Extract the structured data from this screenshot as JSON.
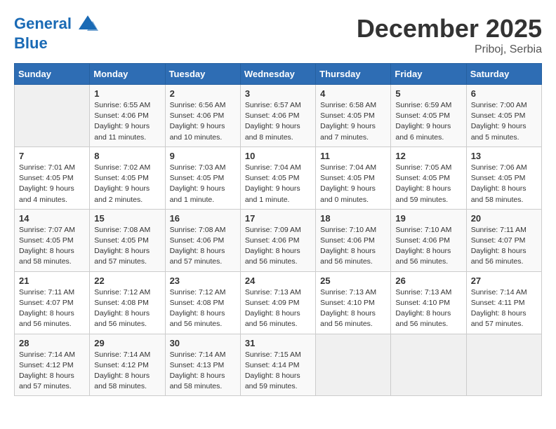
{
  "header": {
    "logo_line1": "General",
    "logo_line2": "Blue",
    "month": "December 2025",
    "location": "Priboj, Serbia"
  },
  "weekdays": [
    "Sunday",
    "Monday",
    "Tuesday",
    "Wednesday",
    "Thursday",
    "Friday",
    "Saturday"
  ],
  "weeks": [
    [
      {
        "day": "",
        "info": ""
      },
      {
        "day": "1",
        "info": "Sunrise: 6:55 AM\nSunset: 4:06 PM\nDaylight: 9 hours\nand 11 minutes."
      },
      {
        "day": "2",
        "info": "Sunrise: 6:56 AM\nSunset: 4:06 PM\nDaylight: 9 hours\nand 10 minutes."
      },
      {
        "day": "3",
        "info": "Sunrise: 6:57 AM\nSunset: 4:06 PM\nDaylight: 9 hours\nand 8 minutes."
      },
      {
        "day": "4",
        "info": "Sunrise: 6:58 AM\nSunset: 4:05 PM\nDaylight: 9 hours\nand 7 minutes."
      },
      {
        "day": "5",
        "info": "Sunrise: 6:59 AM\nSunset: 4:05 PM\nDaylight: 9 hours\nand 6 minutes."
      },
      {
        "day": "6",
        "info": "Sunrise: 7:00 AM\nSunset: 4:05 PM\nDaylight: 9 hours\nand 5 minutes."
      }
    ],
    [
      {
        "day": "7",
        "info": "Sunrise: 7:01 AM\nSunset: 4:05 PM\nDaylight: 9 hours\nand 4 minutes."
      },
      {
        "day": "8",
        "info": "Sunrise: 7:02 AM\nSunset: 4:05 PM\nDaylight: 9 hours\nand 2 minutes."
      },
      {
        "day": "9",
        "info": "Sunrise: 7:03 AM\nSunset: 4:05 PM\nDaylight: 9 hours\nand 1 minute."
      },
      {
        "day": "10",
        "info": "Sunrise: 7:04 AM\nSunset: 4:05 PM\nDaylight: 9 hours\nand 1 minute."
      },
      {
        "day": "11",
        "info": "Sunrise: 7:04 AM\nSunset: 4:05 PM\nDaylight: 9 hours\nand 0 minutes."
      },
      {
        "day": "12",
        "info": "Sunrise: 7:05 AM\nSunset: 4:05 PM\nDaylight: 8 hours\nand 59 minutes."
      },
      {
        "day": "13",
        "info": "Sunrise: 7:06 AM\nSunset: 4:05 PM\nDaylight: 8 hours\nand 58 minutes."
      }
    ],
    [
      {
        "day": "14",
        "info": "Sunrise: 7:07 AM\nSunset: 4:05 PM\nDaylight: 8 hours\nand 58 minutes."
      },
      {
        "day": "15",
        "info": "Sunrise: 7:08 AM\nSunset: 4:05 PM\nDaylight: 8 hours\nand 57 minutes."
      },
      {
        "day": "16",
        "info": "Sunrise: 7:08 AM\nSunset: 4:06 PM\nDaylight: 8 hours\nand 57 minutes."
      },
      {
        "day": "17",
        "info": "Sunrise: 7:09 AM\nSunset: 4:06 PM\nDaylight: 8 hours\nand 56 minutes."
      },
      {
        "day": "18",
        "info": "Sunrise: 7:10 AM\nSunset: 4:06 PM\nDaylight: 8 hours\nand 56 minutes."
      },
      {
        "day": "19",
        "info": "Sunrise: 7:10 AM\nSunset: 4:06 PM\nDaylight: 8 hours\nand 56 minutes."
      },
      {
        "day": "20",
        "info": "Sunrise: 7:11 AM\nSunset: 4:07 PM\nDaylight: 8 hours\nand 56 minutes."
      }
    ],
    [
      {
        "day": "21",
        "info": "Sunrise: 7:11 AM\nSunset: 4:07 PM\nDaylight: 8 hours\nand 56 minutes."
      },
      {
        "day": "22",
        "info": "Sunrise: 7:12 AM\nSunset: 4:08 PM\nDaylight: 8 hours\nand 56 minutes."
      },
      {
        "day": "23",
        "info": "Sunrise: 7:12 AM\nSunset: 4:08 PM\nDaylight: 8 hours\nand 56 minutes."
      },
      {
        "day": "24",
        "info": "Sunrise: 7:13 AM\nSunset: 4:09 PM\nDaylight: 8 hours\nand 56 minutes."
      },
      {
        "day": "25",
        "info": "Sunrise: 7:13 AM\nSunset: 4:10 PM\nDaylight: 8 hours\nand 56 minutes."
      },
      {
        "day": "26",
        "info": "Sunrise: 7:13 AM\nSunset: 4:10 PM\nDaylight: 8 hours\nand 56 minutes."
      },
      {
        "day": "27",
        "info": "Sunrise: 7:14 AM\nSunset: 4:11 PM\nDaylight: 8 hours\nand 57 minutes."
      }
    ],
    [
      {
        "day": "28",
        "info": "Sunrise: 7:14 AM\nSunset: 4:12 PM\nDaylight: 8 hours\nand 57 minutes."
      },
      {
        "day": "29",
        "info": "Sunrise: 7:14 AM\nSunset: 4:12 PM\nDaylight: 8 hours\nand 58 minutes."
      },
      {
        "day": "30",
        "info": "Sunrise: 7:14 AM\nSunset: 4:13 PM\nDaylight: 8 hours\nand 58 minutes."
      },
      {
        "day": "31",
        "info": "Sunrise: 7:15 AM\nSunset: 4:14 PM\nDaylight: 8 hours\nand 59 minutes."
      },
      {
        "day": "",
        "info": ""
      },
      {
        "day": "",
        "info": ""
      },
      {
        "day": "",
        "info": ""
      }
    ]
  ]
}
